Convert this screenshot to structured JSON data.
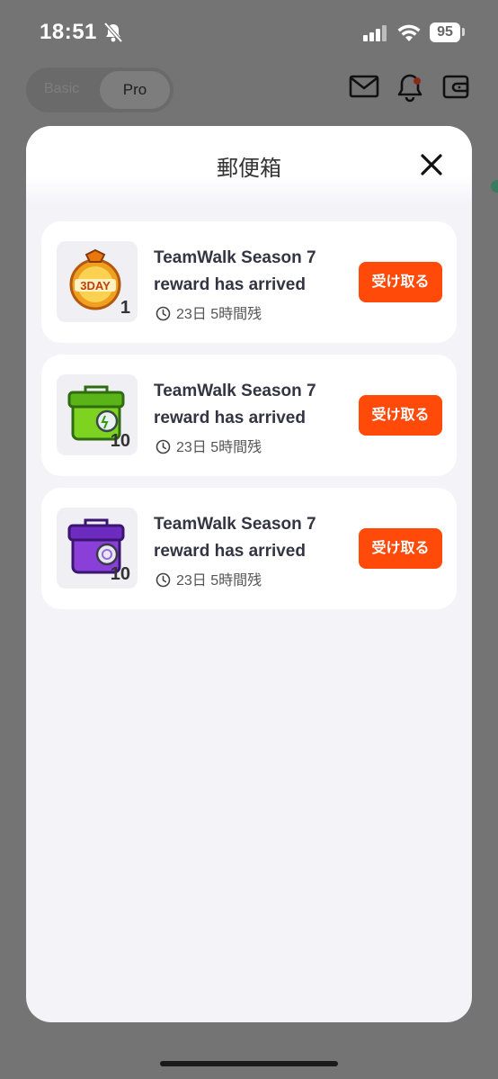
{
  "status_bar": {
    "time": "18:51",
    "battery": "95",
    "icons": [
      "bell-slash-icon",
      "cellular-signal-icon",
      "wifi-icon",
      "battery-icon"
    ]
  },
  "header": {
    "mode_basic": "Basic",
    "mode_pro": "Pro",
    "icons": [
      "mail-icon",
      "bell-icon",
      "wallet-icon"
    ]
  },
  "modal": {
    "title": "郵便箱",
    "close_icon": "close-icon",
    "items": [
      {
        "icon": "3day-potion-icon",
        "quantity": "1",
        "title": "TeamWalk Season 7 reward has arrived",
        "timer": "23日 5時間残",
        "button": "受け取る"
      },
      {
        "icon": "green-treasure-box-icon",
        "quantity": "10",
        "title": "TeamWalk Season 7 reward has arrived",
        "timer": "23日 5時間残",
        "button": "受け取る"
      },
      {
        "icon": "purple-treasure-box-icon",
        "quantity": "10",
        "title": "TeamWalk Season 7 reward has arrived",
        "timer": "23日 5時間残",
        "button": "受け取る"
      }
    ]
  },
  "colors": {
    "accent": "#ff4a0a",
    "overlay": "#747474",
    "modal_bg": "#f3f3f8"
  }
}
